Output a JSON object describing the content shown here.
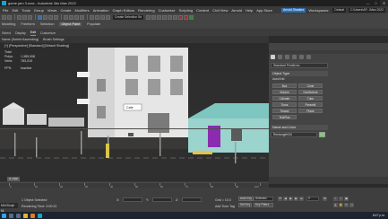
{
  "window": {
    "title": "game.jam 3.max - Autodesk 3ds Max 2022",
    "minimize": "—",
    "maximize": "□",
    "close": "✕"
  },
  "menu": {
    "items": [
      "File",
      "Edit",
      "Tools",
      "Group",
      "Views",
      "Create",
      "Modifiers",
      "Animation",
      "Graph Editors",
      "Rendering",
      "Customize",
      "Scripting",
      "Content",
      "Civil View",
      "Arnold",
      "Help",
      "App Store"
    ],
    "user": "Arnold Shaders",
    "workspace_label": "Workspaces:",
    "workspace_value": "Default",
    "path": "C:\\Users\\AP...\\Max 2022"
  },
  "toolbar": {
    "ribbon_tabs": [
      "Modeling",
      "Freeform",
      "Selection",
      "Object Paint",
      "Populate"
    ],
    "active_ribbon": "Object Paint",
    "selection_set": "Create Selection Se"
  },
  "scene_explorer": {
    "tabs": [
      "Select",
      "Display",
      "Edit",
      "Customize"
    ],
    "sub": [
      "Name (Sorted Ascending)",
      "Brush Settings"
    ]
  },
  "viewport": {
    "label": "[+] [Perspective] [Standard] [Default Shading]",
    "stats_title": "Total",
    "polys_label": "Polys:",
    "polys_value": "1,385,008",
    "verts_label": "Verts:",
    "verts_value": "783,015",
    "fps_label": "FPS:",
    "fps_value": "Inactive",
    "sign_text": "Cafe"
  },
  "command_panel": {
    "category": "Standard Primitives",
    "object_type_header": "Object Type",
    "autogrid": "AutoGrid",
    "buttons": [
      "Box",
      "Cone",
      "Sphere",
      "GeoSphere",
      "Cylinder",
      "Tube",
      "Torus",
      "Pyramid",
      "Teapot",
      "Plane",
      "TextPlus",
      ""
    ],
    "name_color_header": "Name and Color",
    "name_value": "Rectangle034",
    "swatch_color": "#7bd06b"
  },
  "timeline": {
    "thumb": "0 / 100",
    "ticks": [
      "0",
      "10",
      "20",
      "30",
      "40",
      "50",
      "60",
      "70",
      "80",
      "90",
      "100"
    ]
  },
  "status": {
    "selection": "1 Object Selected",
    "hint": "Rendering Time: 0:00:31",
    "x_label": "X:",
    "x_value": "",
    "y_label": "Y:",
    "y_value": "",
    "z_label": "Z:",
    "z_value": "",
    "grid": "Grid = 10.0",
    "add_time_tag": "Add Time Tag",
    "auto_key": "Auto Key",
    "selected": "Selected",
    "set_key": "Set Key",
    "key_filters": "Key Filters...",
    "frame": "0",
    "maxscript": "MAXScript Mi"
  },
  "taskbar": {
    "time": "8:47 p.m.",
    "date": "28/01/2023"
  }
}
